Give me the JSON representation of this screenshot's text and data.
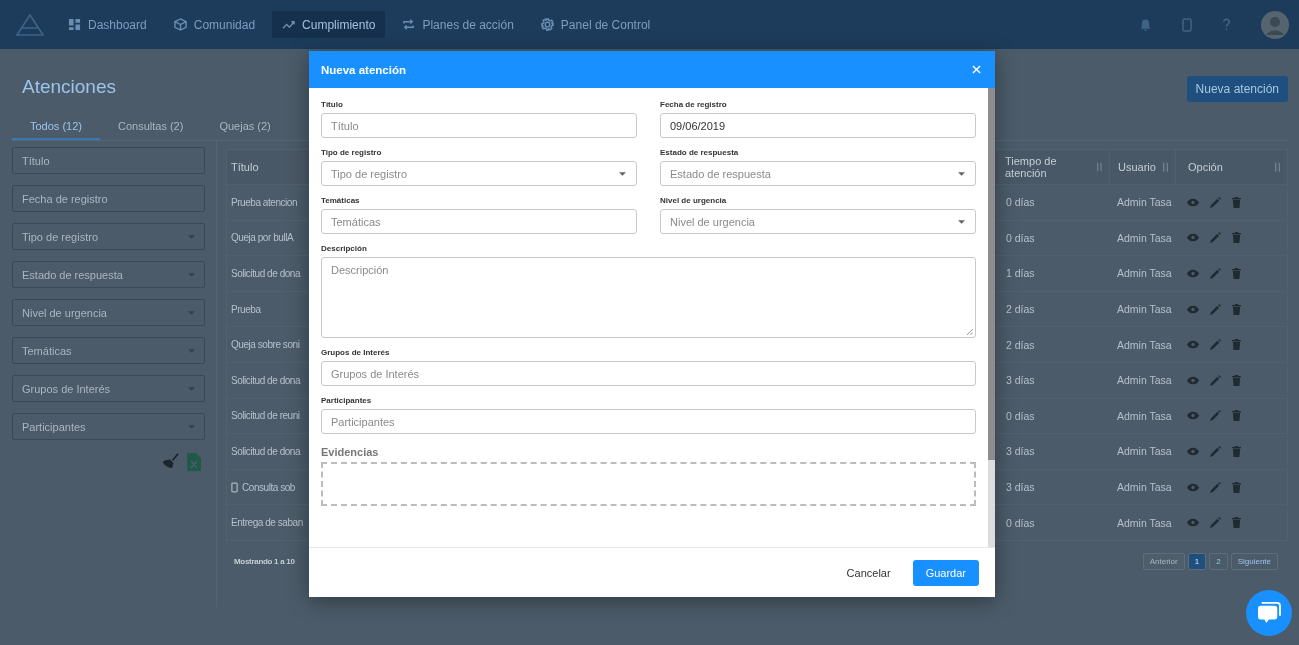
{
  "nav": {
    "items": [
      {
        "label": "Dashboard",
        "selected": false
      },
      {
        "label": "Comunidad",
        "selected": false
      },
      {
        "label": "Cumplimiento",
        "selected": true
      },
      {
        "label": "Planes de acción",
        "selected": false
      },
      {
        "label": "Panel de Control",
        "selected": false
      }
    ]
  },
  "page": {
    "title": "Atenciones",
    "new_button": "Nueva atención",
    "tabs": [
      {
        "label": "Todos (12)",
        "selected": true
      },
      {
        "label": "Consultas (2)",
        "selected": false
      },
      {
        "label": "Quejas (2)",
        "selected": false
      }
    ],
    "filters": [
      {
        "placeholder": "Título",
        "kind": "input"
      },
      {
        "placeholder": "Fecha de registro",
        "kind": "input"
      },
      {
        "placeholder": "Tipo de registro",
        "kind": "select"
      },
      {
        "placeholder": "Estado de respuesta",
        "kind": "select"
      },
      {
        "placeholder": "Nivel de urgencia",
        "kind": "select"
      },
      {
        "placeholder": "Temáticas",
        "kind": "select"
      },
      {
        "placeholder": "Grupos de Interés",
        "kind": "select"
      },
      {
        "placeholder": "Participantes",
        "kind": "select"
      }
    ],
    "table": {
      "columns": [
        "Título",
        "Tiempo de atención",
        "Usuario",
        "Opción"
      ],
      "rows": [
        {
          "title": "Prueba atencion",
          "phone": false,
          "time": "0 días",
          "user": "Admin Tasa"
        },
        {
          "title": "Queja por bullA",
          "phone": false,
          "time": "0 días",
          "user": "Admin Tasa"
        },
        {
          "title": "Solicitud de dona",
          "phone": false,
          "time": "1 días",
          "user": "Admin Tasa"
        },
        {
          "title": "Prueba",
          "phone": false,
          "time": "2 días",
          "user": "Admin Tasa"
        },
        {
          "title": "Queja sobre soni",
          "phone": false,
          "time": "2 días",
          "user": "Admin Tasa"
        },
        {
          "title": "Solicitud de dona",
          "phone": false,
          "time": "3 días",
          "user": "Admin Tasa"
        },
        {
          "title": "Solicitud de reuni",
          "phone": false,
          "time": "0 días",
          "user": "Admin Tasa"
        },
        {
          "title": "Solicitud de dona",
          "phone": false,
          "time": "3 días",
          "user": "Admin Tasa"
        },
        {
          "title": "Consulta sob",
          "phone": true,
          "time": "3 días",
          "user": "Admin Tasa"
        },
        {
          "title": "Entrega de saban",
          "phone": false,
          "time": "0 días",
          "user": "Admin Tasa"
        }
      ]
    },
    "summary": "Mostrando 1 a 10",
    "pagination": [
      {
        "label": "Anterior",
        "selected": false,
        "disabled": true
      },
      {
        "label": "1",
        "selected": true,
        "disabled": false
      },
      {
        "label": "2",
        "selected": false,
        "disabled": false
      },
      {
        "label": "Siguiente",
        "selected": false,
        "disabled": false
      }
    ]
  },
  "modal": {
    "title": "Nueva atención",
    "rows": [
      [
        {
          "label": "Título",
          "kind": "input",
          "placeholder": "Título"
        },
        {
          "label": "Fecha de registro",
          "kind": "input",
          "value": "09/06/2019"
        }
      ],
      [
        {
          "label": "Tipo de registro",
          "kind": "select",
          "placeholder": "Tipo de registro"
        },
        {
          "label": "Estado de respuesta",
          "kind": "select",
          "placeholder": "Estado de respuesta"
        }
      ],
      [
        {
          "label": "Temáticas",
          "kind": "input",
          "placeholder": "Temáticas"
        },
        {
          "label": "Nivel de urgencia",
          "kind": "select",
          "placeholder": "Nivel de urgencia"
        }
      ],
      [
        {
          "label": "Descripción",
          "kind": "textarea",
          "placeholder": "Descripción"
        }
      ],
      [
        {
          "label": "Grupos de Interés",
          "kind": "input",
          "placeholder": "Grupos de Interés"
        }
      ],
      [
        {
          "label": "Participantes",
          "kind": "input",
          "placeholder": "Participantes"
        }
      ]
    ],
    "evidence_label": "Evidencias",
    "buttons": [
      {
        "label": "Cancelar",
        "kind": "text"
      },
      {
        "label": "Guardar",
        "kind": "primary"
      }
    ]
  }
}
